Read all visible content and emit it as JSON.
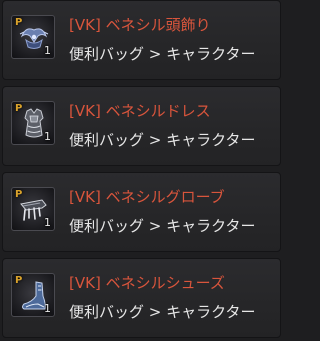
{
  "items": [
    {
      "name": "[VK] ベネシル頭飾り",
      "category": "便利バッグ > キャラクター",
      "grade": "P",
      "count": "1",
      "icon": "head-accessory-icon"
    },
    {
      "name": "[VK] ベネシルドレス",
      "category": "便利バッグ > キャラクター",
      "grade": "P",
      "count": "1",
      "icon": "dress-icon"
    },
    {
      "name": "[VK] ベネシルグローブ",
      "category": "便利バッグ > キャラクター",
      "grade": "P",
      "count": "1",
      "icon": "glove-icon"
    },
    {
      "name": "[VK] ベネシルシューズ",
      "category": "便利バッグ > キャラクター",
      "grade": "P",
      "count": "1",
      "icon": "shoes-icon"
    }
  ],
  "colors": {
    "name_text": "#d9553c",
    "category_text": "#e6e6e6",
    "grade_badge": "#d9a22b",
    "background": "#1e1e20"
  }
}
